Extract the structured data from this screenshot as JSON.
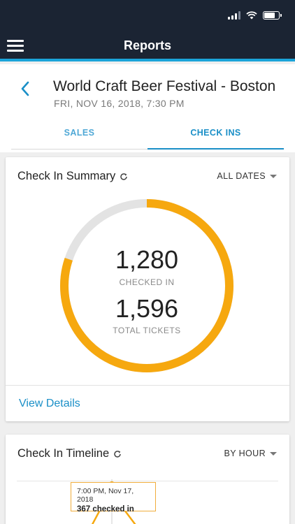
{
  "nav": {
    "title": "Reports"
  },
  "event": {
    "title": "World Craft Beer Festival - Boston",
    "date": "FRI, NOV 16, 2018, 7:30 PM"
  },
  "tabs": [
    {
      "label": "SALES",
      "active": false
    },
    {
      "label": "CHECK INS",
      "active": true
    }
  ],
  "summary": {
    "title": "Check In Summary",
    "filter": "ALL DATES",
    "checked_in_value": "1,280",
    "checked_in_label": "CHECKED IN",
    "total_value": "1,596",
    "total_label": "TOTAL TICKETS",
    "checked_in": 1280,
    "total": 1596,
    "view_details": "View Details"
  },
  "timeline": {
    "title": "Check In Timeline",
    "filter": "BY HOUR",
    "tooltip_time": "7:00 PM, Nov 17, 2018",
    "tooltip_value": "367 checked in"
  },
  "colors": {
    "accent": "#1a8fc7",
    "progress": "#f6a80f",
    "track": "#e3e3e3",
    "navbar": "#1b2433"
  }
}
